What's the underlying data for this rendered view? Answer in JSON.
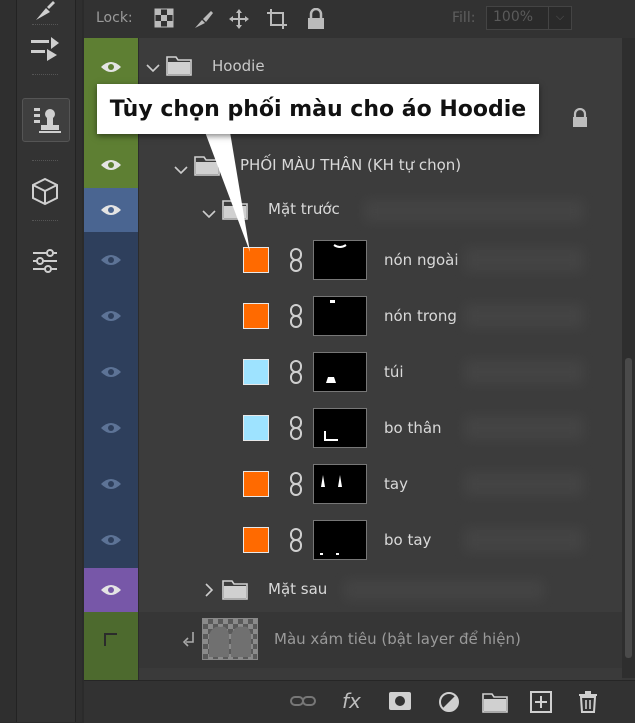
{
  "lockbar": {
    "lock_label": "Lock:",
    "fill_label": "Fill:",
    "fill_value": "100%"
  },
  "callout": {
    "text": "Tùy chọn phối màu cho áo Hoodie"
  },
  "layers": {
    "hoodie": {
      "name": "Hoodie"
    },
    "phoi_mau": {
      "name": "PHỐI MÀU THÂN (KH tự chọn)"
    },
    "mat_truoc": {
      "name": "Mặt trước"
    },
    "items": [
      {
        "name": "nón ngoài",
        "color": "#ff6a00"
      },
      {
        "name": "nón trong",
        "color": "#ff6a00"
      },
      {
        "name": "túi",
        "color": "#9ee3ff"
      },
      {
        "name": "bo thân",
        "color": "#9ee3ff"
      },
      {
        "name": "tay",
        "color": "#ff6a00"
      },
      {
        "name": "bo tay",
        "color": "#ff6a00"
      }
    ],
    "mat_sau": {
      "name": "Mặt sau"
    },
    "mau_xam": {
      "name": "Màu xám tiêu (bật layer để hiện)"
    }
  },
  "footer": {
    "fx_label": "fx"
  }
}
